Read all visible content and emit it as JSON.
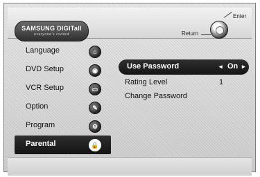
{
  "header": {
    "brand": "SAMSUNG DIGITall",
    "tagline": "everyone's invited",
    "enter_label": "Enter",
    "return_label": "Return"
  },
  "menu": {
    "items": [
      {
        "label": "Language",
        "icon": "language-icon",
        "glyph": "⌂"
      },
      {
        "label": "DVD Setup",
        "icon": "dvd-icon",
        "glyph": "◉"
      },
      {
        "label": "VCR Setup",
        "icon": "vcr-icon",
        "glyph": "▭"
      },
      {
        "label": "Option",
        "icon": "option-icon",
        "glyph": "✎"
      },
      {
        "label": "Program",
        "icon": "program-icon",
        "glyph": "⚙"
      },
      {
        "label": "Parental",
        "icon": "lock-icon",
        "glyph": "🔒"
      }
    ],
    "selected": "Parental"
  },
  "parental": {
    "use_password_label": "Use Password",
    "use_password_value": "On",
    "left_arrow": "◂",
    "right_arrow": "▸",
    "rating_level_label": "Rating Level",
    "rating_level_value": "1",
    "change_password_label": "Change Password"
  },
  "colors": {
    "selected_background": "#1a1a1a",
    "selected_text": "#ffffff",
    "panel_background": "#d9d9d9"
  }
}
